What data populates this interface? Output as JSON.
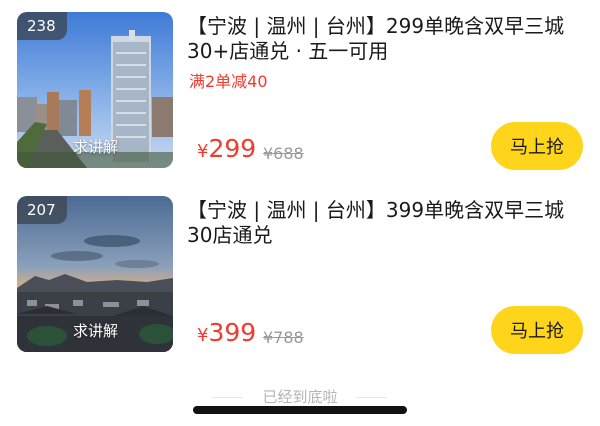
{
  "products": [
    {
      "badge": "238",
      "explain_label": "求讲解",
      "title_line1": "【宁波 | 温州 | 台州】299单晚含双早三城",
      "title_line2": "30+店通兑 · 五一可用",
      "promo": "满2单减40",
      "currency": "¥",
      "price": "299",
      "original_price": "¥688",
      "buy_label": "马上抢"
    },
    {
      "badge": "207",
      "explain_label": "求讲解",
      "title_line1": "【宁波 | 温州 | 台州】399单晚含双早三城",
      "title_line2": "30店通兑",
      "promo": "",
      "currency": "¥",
      "price": "399",
      "original_price": "¥788",
      "buy_label": "马上抢"
    }
  ],
  "footer": {
    "end_text": "已经到底啦"
  },
  "colors": {
    "accent_red": "#f23b2e",
    "button_yellow": "#ffd51c",
    "strike_gray": "#9a9a9a"
  }
}
